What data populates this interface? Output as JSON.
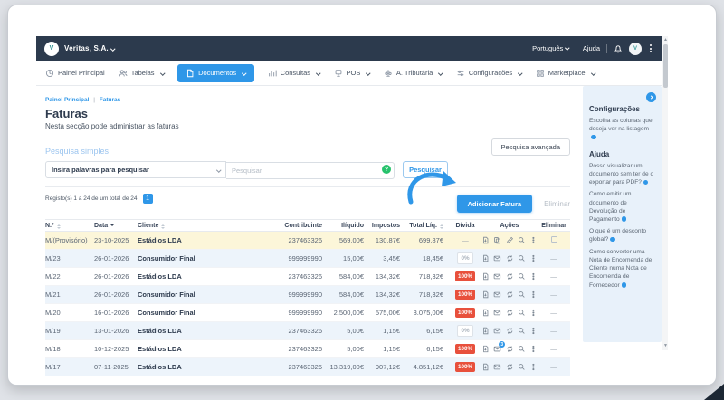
{
  "colors": {
    "accent_blue": "#2f97e8",
    "navbar_dark": "#2c3a4d",
    "danger_red": "#e8503c",
    "success_green": "#27c26c",
    "highlight_row": "#fcf6d9",
    "sidebar_bg": "#e8f1fa"
  },
  "topbar": {
    "company": "Veritas, S.A.",
    "language": "Português",
    "help": "Ajuda"
  },
  "menu": {
    "items": [
      {
        "label": "Painel Principal",
        "icon": "clock-icon",
        "dropdown": false,
        "active": false
      },
      {
        "label": "Tabelas",
        "icon": "people-icon",
        "dropdown": true,
        "active": false
      },
      {
        "label": "Documentos",
        "icon": "document-icon",
        "dropdown": true,
        "active": true
      },
      {
        "label": "Consultas",
        "icon": "bar-chart-icon",
        "dropdown": true,
        "active": false
      },
      {
        "label": "POS",
        "icon": "pos-terminal-icon",
        "dropdown": true,
        "active": false
      },
      {
        "label": "A. Tributária",
        "icon": "tax-icon",
        "dropdown": true,
        "active": false
      },
      {
        "label": "Configurações",
        "icon": "sliders-icon",
        "dropdown": true,
        "active": false
      },
      {
        "label": "Marketplace",
        "icon": "grid-icon",
        "dropdown": true,
        "active": false
      }
    ]
  },
  "breadcrumb": {
    "items": [
      "Painel Principal",
      "Faturas"
    ]
  },
  "page": {
    "title": "Faturas",
    "subtitle": "Nesta secção pode administrar as faturas"
  },
  "search": {
    "section_title": "Pesquisa simples",
    "field_label": "Insira palavras para pesquisar",
    "placeholder": "Pesquisar",
    "help_mark": "?",
    "search_button": "Pesquisar",
    "advanced_button": "Pesquisa avançada"
  },
  "pagination": {
    "info": "Registo(s) 1 a 24 de um total de 24",
    "page": "1"
  },
  "actions": {
    "add_button": "Adicionar Fatura",
    "delete_button": "Eliminar"
  },
  "table": {
    "headers": [
      "N.º",
      "Data",
      "Cliente",
      "Contribuinte",
      "Ilíquido",
      "Impostos",
      "Total Líq.",
      "Dívida",
      "Ações",
      "Eliminar"
    ],
    "rows": [
      {
        "num": "M/(Provisório)",
        "date": "23-10-2025",
        "client": "Estádios LDA",
        "vat": "237463326",
        "net": "569,00€",
        "tax": "130,87€",
        "total": "699,87€",
        "debt": "—",
        "debt_type": "none"
      },
      {
        "num": "M/23",
        "date": "26-01-2026",
        "client": "Consumidor Final",
        "vat": "999999990",
        "net": "15,00€",
        "tax": "3,45€",
        "total": "18,45€",
        "debt": "0%",
        "debt_type": "zero"
      },
      {
        "num": "M/22",
        "date": "26-01-2026",
        "client": "Estádios LDA",
        "vat": "237463326",
        "net": "584,00€",
        "tax": "134,32€",
        "total": "718,32€",
        "debt": "100%",
        "debt_type": "full"
      },
      {
        "num": "M/21",
        "date": "26-01-2026",
        "client": "Consumidor Final",
        "vat": "999999990",
        "net": "584,00€",
        "tax": "134,32€",
        "total": "718,32€",
        "debt": "100%",
        "debt_type": "full"
      },
      {
        "num": "M/20",
        "date": "16-01-2026",
        "client": "Consumidor Final",
        "vat": "999999990",
        "net": "2.500,00€",
        "tax": "575,00€",
        "total": "3.075,00€",
        "debt": "100%",
        "debt_type": "full"
      },
      {
        "num": "M/19",
        "date": "13-01-2026",
        "client": "Estádios LDA",
        "vat": "237463326",
        "net": "5,00€",
        "tax": "1,15€",
        "total": "6,15€",
        "debt": "0%",
        "debt_type": "zero"
      },
      {
        "num": "M/18",
        "date": "10-12-2025",
        "client": "Estádios LDA",
        "vat": "237463326",
        "net": "5,00€",
        "tax": "1,15€",
        "total": "6,15€",
        "debt": "100%",
        "debt_type": "full",
        "mail_badge": "3"
      },
      {
        "num": "M/17",
        "date": "07-11-2025",
        "client": "Estádios LDA",
        "vat": "237463326",
        "net": "13.319,00€",
        "tax": "907,12€",
        "total": "4.851,12€",
        "debt": "100%",
        "debt_type": "full"
      }
    ]
  },
  "sidebar": {
    "sections": [
      {
        "title": "Configurações",
        "items": [
          {
            "text": "Escolha as colunas que deseja ver na listagem"
          }
        ]
      },
      {
        "title": "Ajuda",
        "items": [
          {
            "text": "Posso visualizar um documento sem ter de o exportar para PDF?"
          },
          {
            "text": "Como emitir um documento de Devolução de Pagamento"
          },
          {
            "text": "O que é um desconto global?"
          },
          {
            "text": "Como converter uma Nota de Encomenda de Cliente numa Nota de Encomenda de Fornecedor"
          }
        ]
      }
    ]
  }
}
